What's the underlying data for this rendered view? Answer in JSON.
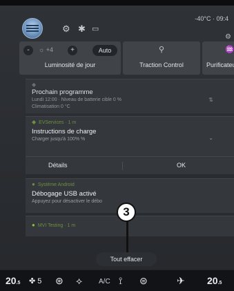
{
  "status_bar": {
    "temperature": "-40°C",
    "time": "09:4"
  },
  "quick_tiles": {
    "brightness": {
      "value": "+4",
      "auto_label": "Auto",
      "label": "Luminosité de jour"
    },
    "traction": {
      "label": "Traction Control"
    },
    "purifier": {
      "label": "Purificateur d'air"
    }
  },
  "notifications": [
    {
      "title": "Prochain programme",
      "line1": "Lundi 12:00 · Niveau de batterie cible 0 %",
      "line2": "Climatisation 0 °C"
    },
    {
      "source": "EVServices · 1 m",
      "title": "Instructions de charge",
      "line1": "Charger jusqu'à 100% %",
      "details_label": "Détails",
      "ok_label": "OK"
    },
    {
      "source": "Système Android",
      "title": "Débogage USB activé",
      "line1": "Appuyez pour désactiver le débo"
    },
    {
      "source": "MVI Testing · 1 m"
    }
  ],
  "callout_number": "3",
  "clear_all_label": "Tout effacer",
  "climate_bar": {
    "left_temp": "20",
    "fan_level": "5",
    "ac_label": "A/C",
    "right_temp": "20"
  },
  "colors": {
    "background": "#2d3035",
    "card": "#34373c",
    "climate_bar": "#111317",
    "ev_green": "#6f8f3f"
  }
}
